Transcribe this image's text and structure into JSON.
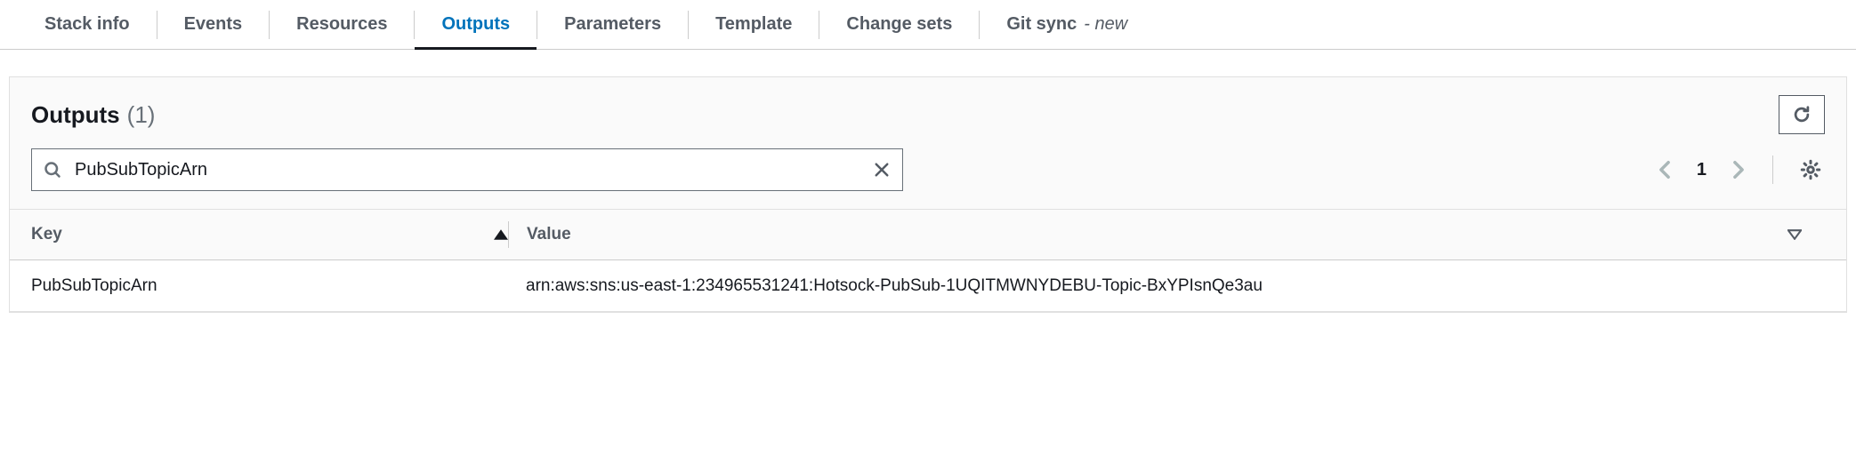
{
  "tabs": [
    {
      "label": "Stack info",
      "active": false
    },
    {
      "label": "Events",
      "active": false
    },
    {
      "label": "Resources",
      "active": false
    },
    {
      "label": "Outputs",
      "active": true
    },
    {
      "label": "Parameters",
      "active": false
    },
    {
      "label": "Template",
      "active": false
    },
    {
      "label": "Change sets",
      "active": false
    },
    {
      "label": "Git sync",
      "active": false,
      "badge": "- new"
    }
  ],
  "panel": {
    "title": "Outputs",
    "count": "(1)"
  },
  "search": {
    "value": "PubSubTopicArn"
  },
  "pagination": {
    "page": "1"
  },
  "table": {
    "columns": {
      "key": "Key",
      "value": "Value"
    },
    "rows": [
      {
        "key": "PubSubTopicArn",
        "value": "arn:aws:sns:us-east-1:234965531241:Hotsock-PubSub-1UQITMWNYDEBU-Topic-BxYPIsnQe3au"
      }
    ]
  }
}
